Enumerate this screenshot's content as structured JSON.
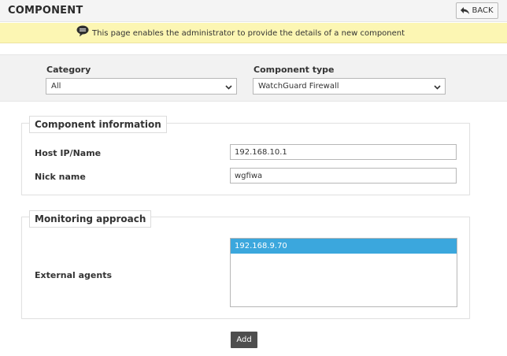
{
  "header": {
    "title": "COMPONENT",
    "back_label": "BACK"
  },
  "info": {
    "message": "This page enables the administrator to provide the details of a new component"
  },
  "filters": {
    "category_label": "Category",
    "category_value": "All",
    "component_type_label": "Component type",
    "component_type_value": "WatchGuard Firewall"
  },
  "component_info": {
    "legend": "Component information",
    "host_label": "Host IP/Name",
    "host_value": "192.168.10.1",
    "nick_label": "Nick name",
    "nick_value": "wgfiwa"
  },
  "monitoring": {
    "legend": "Monitoring approach",
    "agents_label": "External agents",
    "agents": [
      "192.168.9.70"
    ],
    "selected_agent": "192.168.9.70"
  },
  "actions": {
    "add_label": "Add"
  },
  "colors": {
    "info_bar": "#fcf6b3",
    "selected_option": "#3ba7dd",
    "add_button": "#4e4e4e"
  }
}
